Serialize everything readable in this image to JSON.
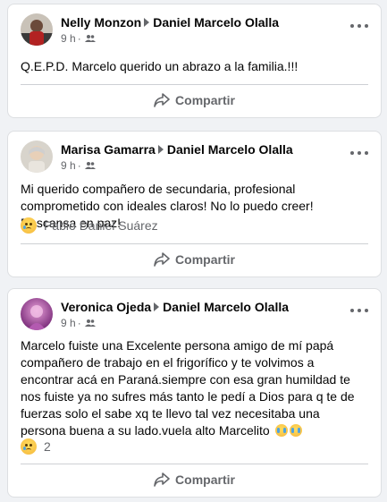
{
  "posts": [
    {
      "author": "Nelly Monzon",
      "target": "Daniel Marcelo Olalla",
      "time": "9 h",
      "dot": "·",
      "audience_icon": "friends-icon",
      "text": "Q.E.P.D. Marcelo querido un abrazo a la familia.!!!",
      "share_label": "Compartir"
    },
    {
      "author": "Marisa Gamarra",
      "target": "Daniel Marcelo Olalla",
      "time": "9 h",
      "dot": "·",
      "audience_icon": "friends-icon",
      "text": "Mi querido compañero de secundaria, profesional comprometido con ideales claros! No lo puedo creer! Descansa en paz!",
      "reaction_text": "Pablo Daniel Suárez",
      "share_label": "Compartir"
    },
    {
      "author": "Veronica Ojeda",
      "target": "Daniel Marcelo Olalla",
      "time": "9 h",
      "dot": "·",
      "audience_icon": "friends-icon",
      "text": "Marcelo fuiste una Excelente persona amigo de mí papá compañero de trabajo en el frigorífico y te volvimos a encontrar acá en Paraná.siempre con esa gran humildad te nos fuiste ya no sufres más tanto le pedí a Dios para q te de fuerzas solo el sabe xq te llevo tal vez necesitaba una persona buena a su lado.vuela alto Marcelito",
      "reaction_count": "2",
      "share_label": "Compartir"
    }
  ],
  "colors": {
    "background": "#f0f2f5",
    "card": "#ffffff",
    "secondary_text": "#65676b"
  }
}
